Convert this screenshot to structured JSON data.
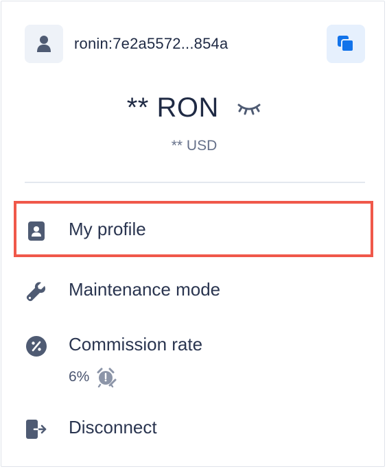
{
  "wallet": {
    "address": "ronin:7e2a5572...854a",
    "balance": "** RON",
    "fiat_balance": "** USD"
  },
  "icons": {
    "avatar": "user-icon",
    "copy": "copy-icon",
    "hide_balance": "eye-closed-icon",
    "profile": "id-card-icon",
    "maintenance": "wrench-icon",
    "commission": "percent-icon",
    "commission_schedule": "alarm-clock-icon",
    "disconnect": "logout-icon"
  },
  "menu": {
    "items": [
      {
        "label": "My profile"
      },
      {
        "label": "Maintenance mode"
      },
      {
        "label": "Commission rate",
        "value": "6%"
      },
      {
        "label": "Disconnect"
      }
    ]
  },
  "colors": {
    "text": "#1f2a44",
    "muted": "#66718a",
    "icon": "#4f5b73",
    "accent": "#1273ea",
    "highlight_border": "#f0584a"
  }
}
